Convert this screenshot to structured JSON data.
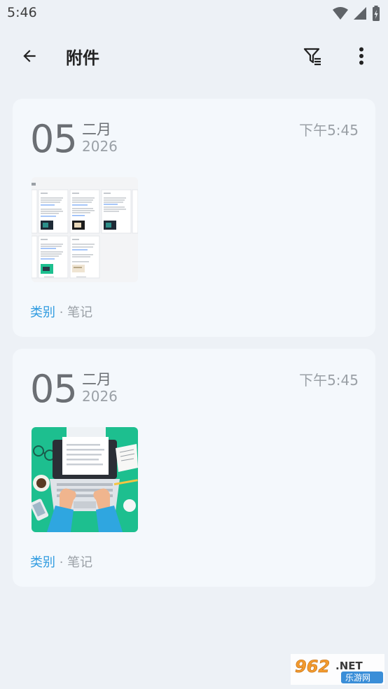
{
  "status_bar": {
    "time": "5:46"
  },
  "app_bar": {
    "title": "附件"
  },
  "cards": [
    {
      "day": "05",
      "month": "二月",
      "year": "2026",
      "time": "下午5:45",
      "category": "类别",
      "separator": " · ",
      "notebook": "笔记",
      "thumbnail": "screenshot-preview"
    },
    {
      "day": "05",
      "month": "二月",
      "year": "2026",
      "time": "下午5:45",
      "category": "类别",
      "separator": " · ",
      "notebook": "笔记",
      "thumbnail": "laptop-illustration"
    }
  ],
  "watermark": {
    "text": "962.NET",
    "subtext": "乐游网"
  },
  "colors": {
    "background": "#edf1f6",
    "card": "#f4f8fc",
    "accent": "#2f9be0",
    "illustration_green": "#1dbf8f"
  }
}
